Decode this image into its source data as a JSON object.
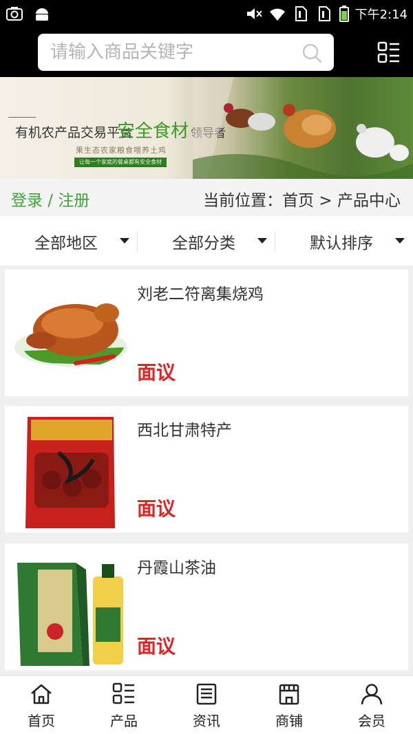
{
  "status_bar": {
    "time": "下午2:14",
    "icons": [
      "camera-icon",
      "android-icon",
      "mute-icon",
      "wifi-icon",
      "sim1-icon",
      "sim2-icon",
      "battery-icon"
    ]
  },
  "header": {
    "search_placeholder": "请输入商品关键字",
    "icons": {
      "search": "search-icon",
      "menu": "grid-menu-icon"
    }
  },
  "banner": {
    "title_left": "有机农产品交易平台",
    "title_highlight": "安全食材",
    "title_right": "领导者",
    "subtitle": "果生态农家粮食喂养土鸡",
    "tagline": "让每一个家庭的餐桌都有安全食材",
    "highlight_color": "#3a9a23"
  },
  "breadcrumb": {
    "login_register": "登录 / 注册",
    "current_location": "当前位置：首页 > 产品中心"
  },
  "filters": [
    {
      "label": "全部地区"
    },
    {
      "label": "全部分类"
    },
    {
      "label": "默认排序"
    }
  ],
  "products": [
    {
      "name": "刘老二符离集烧鸡",
      "price": "面议",
      "image": "roast-chicken-image"
    },
    {
      "name": "西北甘肃特产",
      "price": "面议",
      "image": "red-dates-package-image"
    },
    {
      "name": "丹霞山茶油",
      "price": "面议",
      "image": "tea-oil-box-image"
    }
  ],
  "bottom_nav": [
    {
      "label": "首页",
      "icon": "home-icon"
    },
    {
      "label": "产品",
      "icon": "product-grid-icon"
    },
    {
      "label": "资讯",
      "icon": "news-icon"
    },
    {
      "label": "商铺",
      "icon": "shop-icon"
    },
    {
      "label": "会员",
      "icon": "user-icon"
    }
  ],
  "colors": {
    "accent_green": "#3fa33a",
    "price_red": "#e02323",
    "header_bg": "#000000"
  }
}
